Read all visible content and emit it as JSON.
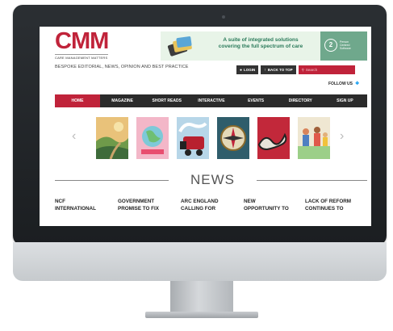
{
  "site": {
    "logo": "CMM",
    "logo_sub": "CARE MANAGEMENT MATTERS",
    "tagline": "BESPOKE EDITORIAL, NEWS, OPINION AND BEST PRACTICE"
  },
  "ad": {
    "line1": "A suite of integrated solutions",
    "line2": "covering the full spectrum of care",
    "cta_mark": "2",
    "cta_line1": "Person",
    "cta_line2": "Centred",
    "cta_line3": "Software"
  },
  "top_buttons": {
    "login": "LOGIN",
    "back_to_top": "BACK TO TOP",
    "search_placeholder": "Search"
  },
  "follow": {
    "label": "FOLLOW US"
  },
  "nav": {
    "items": [
      {
        "label": "HOME"
      },
      {
        "label": "MAGAZINE"
      },
      {
        "label": "SHORT READS"
      },
      {
        "label": "INTERACTIVE"
      },
      {
        "label": "EVENTS"
      },
      {
        "label": "DIRECTORY"
      },
      {
        "label": "SIGN UP"
      }
    ]
  },
  "carousel": {
    "prev_icon": "chevron-left-icon",
    "next_icon": "chevron-right-icon"
  },
  "news": {
    "heading": "NEWS",
    "items": [
      {
        "line1": "NCF",
        "line2": "INTERNATIONAL"
      },
      {
        "line1": "GOVERNMENT",
        "line2": "PROMISE TO FIX"
      },
      {
        "line1": "ARC ENGLAND",
        "line2": "CALLING FOR"
      },
      {
        "line1": "NEW",
        "line2": "OPPORTUNITY TO"
      },
      {
        "line1": "LACK OF REFORM",
        "line2": "CONTINUES TO"
      }
    ]
  },
  "colors": {
    "brand": "#c0233a",
    "nav_bg": "#2b2b2b",
    "ad_green": "#2a7a5a"
  }
}
